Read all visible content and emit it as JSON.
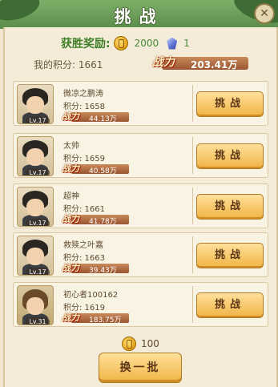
{
  "title": "挑战",
  "reward": {
    "label": "获胜奖励:",
    "coin_amount": "2000",
    "crystal_amount": "1"
  },
  "my_score": "我的积分: 1661",
  "my_power": {
    "tag": "战力",
    "value": "203.41万"
  },
  "opponents": [
    {
      "name": "微凉之鹏涛",
      "level": "Lv.17",
      "score": "积分: 1658",
      "power": "44.13万",
      "button": "挑战"
    },
    {
      "name": "太帅",
      "level": "Lv.17",
      "score": "积分: 1659",
      "power": "40.58万",
      "button": "挑战"
    },
    {
      "name": "超神",
      "level": "Lv.17",
      "score": "积分: 1661",
      "power": "41.78万",
      "button": "挑战"
    },
    {
      "name": "救赎之叶嘉",
      "level": "Lv.17",
      "score": "积分: 1663",
      "power": "39.43万",
      "button": "挑战"
    },
    {
      "name": "初心者100162",
      "level": "Lv.31",
      "score": "积分: 1619",
      "power": "183.75万",
      "button": "挑战"
    }
  ],
  "power_tag": "战力",
  "refresh": {
    "cost": "100",
    "label": "换一批"
  },
  "icons": {
    "coin": "gold-coin-icon",
    "crystal": "blue-crystal-icon",
    "close": "close-icon"
  }
}
